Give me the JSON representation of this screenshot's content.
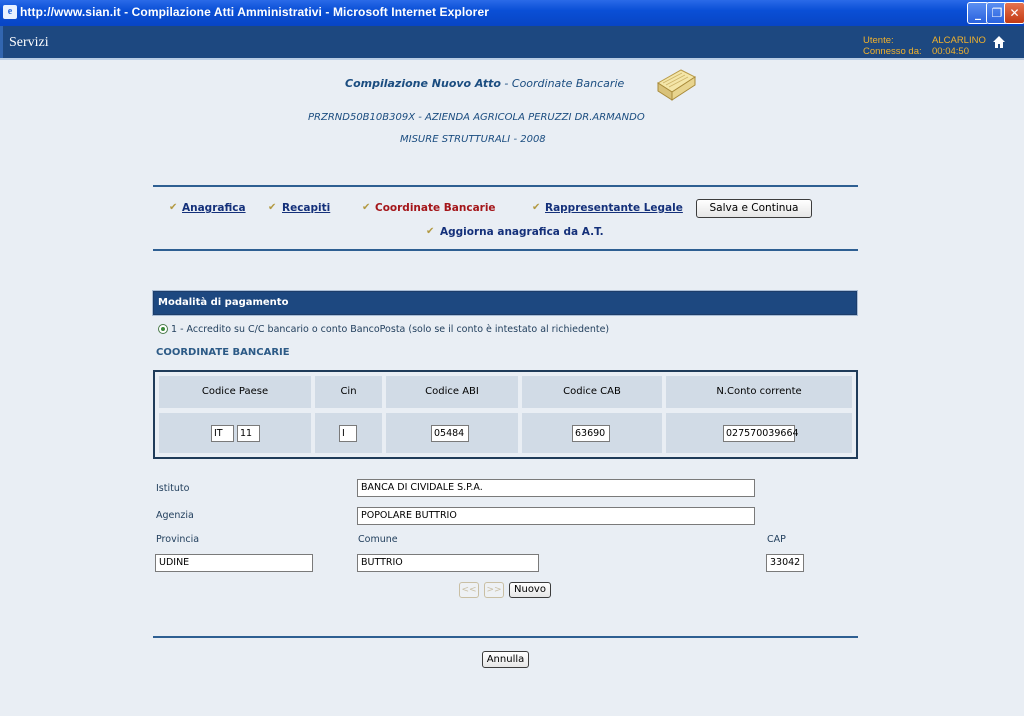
{
  "window": {
    "title": "http://www.sian.it - Compilazione Atti Amministrativi - Microsoft Internet Explorer",
    "minimize_glyph": "_",
    "maximize_glyph": "❐",
    "close_glyph": "✕"
  },
  "header": {
    "servizi": "Servizi",
    "utente_label": "Utente:",
    "utente_value": "ALCARLINO",
    "connesso_label": "Connesso da:",
    "connesso_value": "00:04:50",
    "home_icon": "home-icon"
  },
  "page": {
    "heading_bold": "Compilazione Nuovo Atto",
    "heading_rest": " - Coordinate Bancarie",
    "subject_line": "PRZRND50B10B309X - AZIENDA AGRICOLA PERUZZI DR.ARMANDO",
    "measure_line": "MISURE STRUTTURALI - 2008"
  },
  "nav": {
    "items": [
      {
        "label": "Anagrafica"
      },
      {
        "label": "Recapiti"
      },
      {
        "label": "Coordinate Bancarie",
        "active": true
      },
      {
        "label": "Rappresentante Legale"
      },
      {
        "label": "Aggiorna anagrafica da A.T."
      }
    ],
    "save_button": "Salva e Continua"
  },
  "payment": {
    "section_title": "Modalità di pagamento",
    "option_text": "1 - Accredito su C/C bancario o conto BancoPosta (solo se il conto è intestato al richiedente)",
    "coord_title": "COORDINATE BANCARIE",
    "columns": [
      "Codice Paese",
      "Cin",
      "Codice ABI",
      "Codice CAB",
      "N.Conto corrente"
    ],
    "values": {
      "paese": "IT",
      "check_digits": "11",
      "cin": "I",
      "abi": "05484",
      "cab": "63690",
      "conto": "027570039664"
    }
  },
  "bank": {
    "istituto_label": "Istituto",
    "istituto_value": "BANCA DI CIVIDALE S.P.A.",
    "agenzia_label": "Agenzia",
    "agenzia_value": "POPOLARE BUTTRIO",
    "provincia_label": "Provincia",
    "provincia_value": "UDINE",
    "comune_label": "Comune",
    "comune_value": "BUTTRIO",
    "cap_label": "CAP",
    "cap_value": "33042",
    "prev_button": "<<",
    "next_button": ">>",
    "nuovo_button": "Nuovo"
  },
  "footer": {
    "annulla_button": "Annulla"
  },
  "colors": {
    "header_blue": "#1d4880",
    "active_link": "#a4161a",
    "user_info": "#f2b22b"
  }
}
